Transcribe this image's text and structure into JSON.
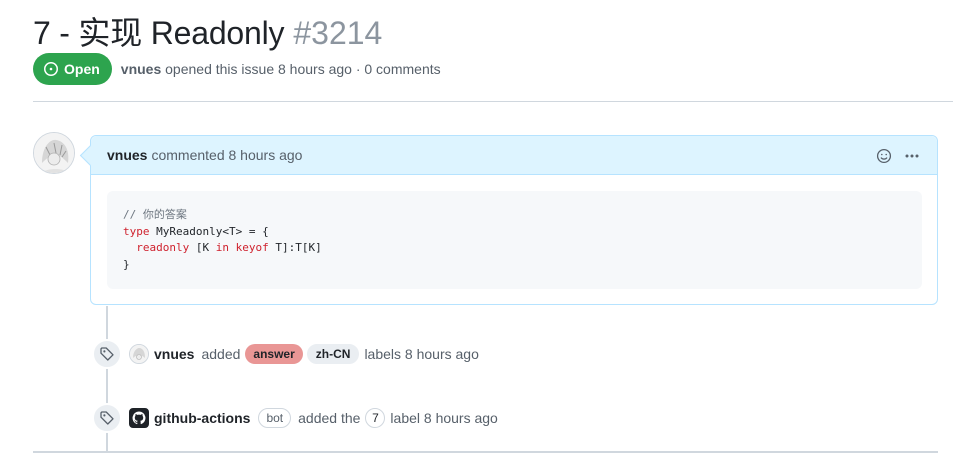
{
  "issue": {
    "title": "7 - 实现 Readonly",
    "number": "#3214",
    "state": "Open",
    "author": "vnues",
    "meta": "opened this issue 8 hours ago · 0 comments"
  },
  "comment": {
    "author": "vnues",
    "meta": "commented 8 hours ago",
    "code": {
      "line1_comment": "// 你的答案",
      "line2_kw": "type",
      "line2_rest": " MyReadonly<T> = {",
      "line3_indent": "  ",
      "line3_kw1": "readonly",
      "line3_mid": " [K ",
      "line3_kw2": "in",
      "line3_sp": " ",
      "line3_kw3": "keyof",
      "line3_rest": " T]:T[K]",
      "line4": "}"
    }
  },
  "events": [
    {
      "actor": "vnues",
      "action": "added",
      "labels": [
        "answer",
        "zh-CN"
      ],
      "suffix": "labels 8 hours ago"
    },
    {
      "actor": "github-actions",
      "bot": "bot",
      "action": "added the",
      "label": "7",
      "suffix": "label 8 hours ago"
    }
  ],
  "colors": {
    "open_green": "#2da44e",
    "comment_header_bg": "#ddf4ff",
    "label_answer": "#e99695",
    "label_zh": "#eaeef2"
  },
  "icons": {
    "state": "issue-opened-icon",
    "reaction": "smiley-icon",
    "menu": "kebab-horizontal-icon",
    "event": "tag-icon"
  }
}
